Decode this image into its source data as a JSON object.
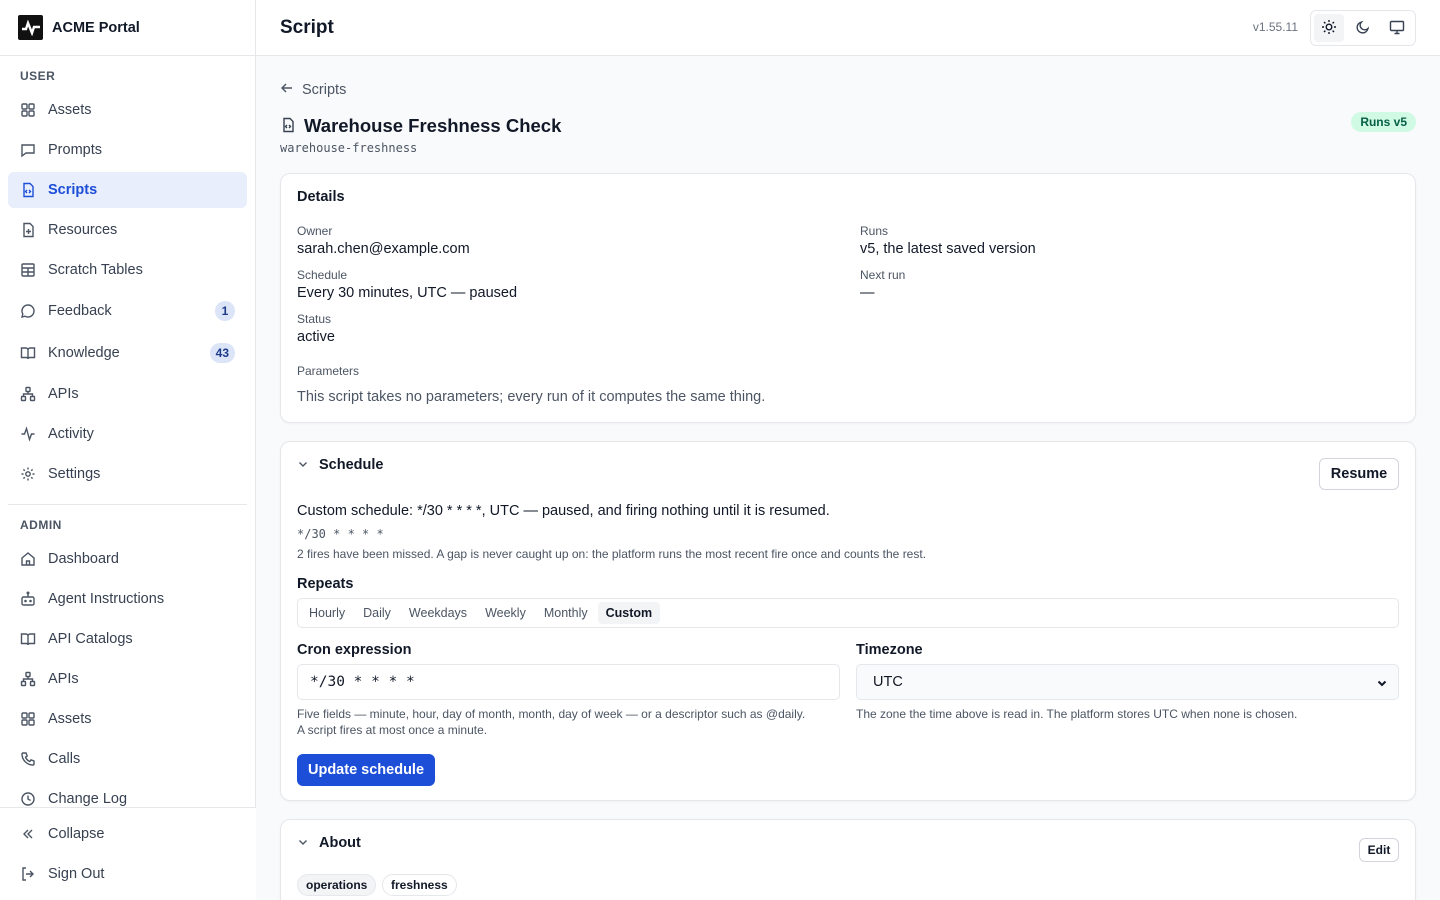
{
  "app": {
    "name": "ACME Portal",
    "version": "v1.55.11"
  },
  "sidebar": {
    "user_label": "USER",
    "admin_label": "ADMIN",
    "user_items": [
      {
        "label": "Assets",
        "icon": "grid-icon"
      },
      {
        "label": "Prompts",
        "icon": "message-square-icon"
      },
      {
        "label": "Scripts",
        "icon": "file-code-icon",
        "active": true
      },
      {
        "label": "Resources",
        "icon": "file-plus-icon"
      },
      {
        "label": "Scratch Tables",
        "icon": "table-icon"
      },
      {
        "label": "Feedback",
        "icon": "message-circle-icon",
        "badge": "1"
      },
      {
        "label": "Knowledge",
        "icon": "book-open-icon",
        "badge": "43"
      },
      {
        "label": "APIs",
        "icon": "network-icon"
      },
      {
        "label": "Activity",
        "icon": "activity-icon"
      },
      {
        "label": "Settings",
        "icon": "gear-icon"
      }
    ],
    "admin_items": [
      {
        "label": "Dashboard",
        "icon": "home-icon"
      },
      {
        "label": "Agent Instructions",
        "icon": "bot-icon"
      },
      {
        "label": "API Catalogs",
        "icon": "book-open-icon"
      },
      {
        "label": "APIs",
        "icon": "network-icon"
      },
      {
        "label": "Assets",
        "icon": "grid-icon"
      },
      {
        "label": "Calls",
        "icon": "phone-icon"
      },
      {
        "label": "Change Log",
        "icon": "clock-icon"
      }
    ],
    "collapse": "Collapse",
    "sign_out": "Sign Out"
  },
  "header": {
    "title": "Script"
  },
  "page": {
    "back": "Scripts",
    "title": "Warehouse Freshness Check",
    "slug": "warehouse-freshness",
    "runs_badge": "Runs v5"
  },
  "details": {
    "heading": "Details",
    "owner_label": "Owner",
    "owner": "sarah.chen@example.com",
    "runs_label": "Runs",
    "runs": "v5, the latest saved version",
    "schedule_label": "Schedule",
    "schedule": "Every 30 minutes, UTC — paused",
    "next_run_label": "Next run",
    "next_run": "—",
    "status_label": "Status",
    "status": "active",
    "params_label": "Parameters",
    "params": "This script takes no parameters; every run of it computes the same thing."
  },
  "schedule": {
    "heading": "Schedule",
    "resume": "Resume",
    "summary": "Custom schedule: */30 * * * *, UTC — paused, and firing nothing until it is resumed.",
    "cron_display": "*/30 * * * *",
    "missed_note": "2 fires have been missed. A gap is never caught up on: the platform runs the most recent fire once and counts the rest.",
    "repeats_label": "Repeats",
    "repeats_options": [
      "Hourly",
      "Daily",
      "Weekdays",
      "Weekly",
      "Monthly",
      "Custom"
    ],
    "repeats_selected": "Custom",
    "cron_label": "Cron expression",
    "cron_value": "*/30 * * * *",
    "cron_help_1": "Five fields — minute, hour, day of month, month, day of week — or a descriptor such as @daily.",
    "cron_help_2": "A script fires at most once a minute.",
    "tz_label": "Timezone",
    "tz_value": "UTC",
    "tz_help": "The zone the time above is read in. The platform stores UTC when none is chosen.",
    "update": "Update schedule"
  },
  "about": {
    "heading": "About",
    "edit": "Edit",
    "tags": [
      "operations",
      "freshness"
    ]
  },
  "colors": {
    "accent": "#1d4ed8",
    "active_bg": "#e8eefb",
    "success_bg": "#d1fae5",
    "success_fg": "#065f46"
  }
}
